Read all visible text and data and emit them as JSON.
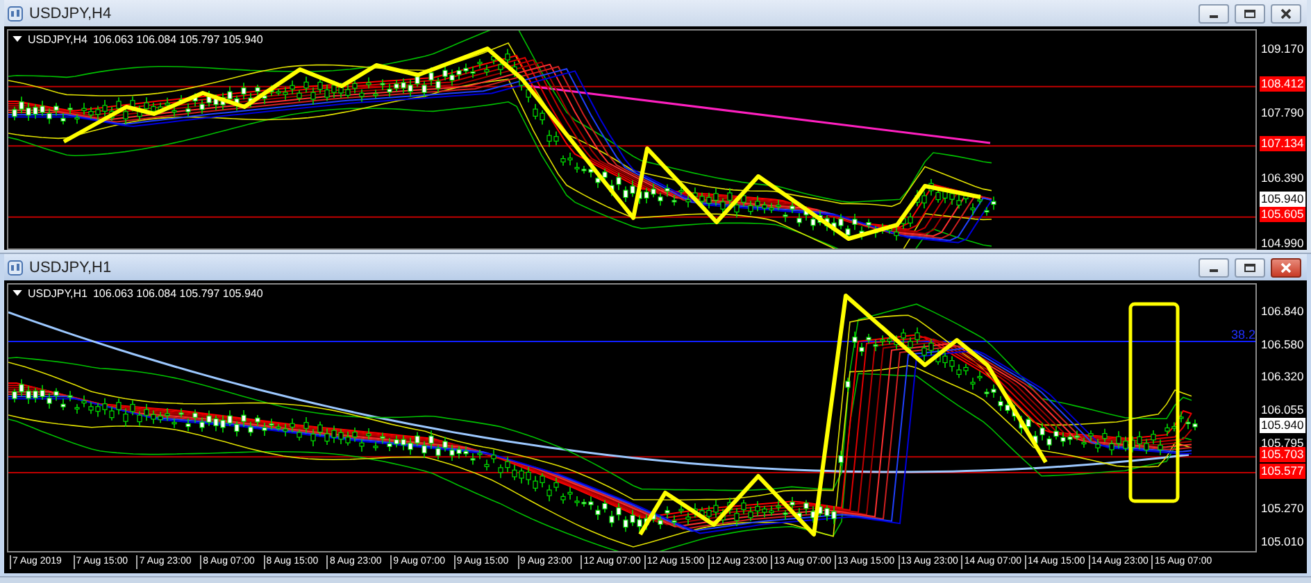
{
  "windows": [
    {
      "title": "USDJPY,H4",
      "active": false,
      "chart_header": {
        "symbol": "USDJPY,H4",
        "quote": "106.063 106.084 105.797 105.940"
      },
      "price_axis": [
        {
          "text": "109.170",
          "kind": "tick"
        },
        {
          "text": "108.412",
          "kind": "line"
        },
        {
          "text": "107.790",
          "kind": "tick"
        },
        {
          "text": "107.134",
          "kind": "line"
        },
        {
          "text": "106.390",
          "kind": "tick"
        },
        {
          "text": "105.940",
          "kind": "current"
        },
        {
          "text": "105.605",
          "kind": "line"
        },
        {
          "text": "104.990",
          "kind": "tick"
        }
      ]
    },
    {
      "title": "USDJPY,H1",
      "active": true,
      "chart_header": {
        "symbol": "USDJPY,H1",
        "quote": "106.063 106.084 105.797 105.940"
      },
      "fib_label": "38.2",
      "price_axis": [
        {
          "text": "106.840",
          "kind": "tick"
        },
        {
          "text": "106.580",
          "kind": "tick"
        },
        {
          "text": "106.320",
          "kind": "tick"
        },
        {
          "text": "106.055",
          "kind": "tick"
        },
        {
          "text": "105.940",
          "kind": "current"
        },
        {
          "text": "105.795",
          "kind": "tick"
        },
        {
          "text": "105.703",
          "kind": "line"
        },
        {
          "text": "105.577",
          "kind": "line"
        },
        {
          "text": "105.270",
          "kind": "tick"
        },
        {
          "text": "105.010",
          "kind": "tick"
        }
      ],
      "time_axis": [
        "7 Aug 2019",
        "7 Aug 15:00",
        "7 Aug 23:00",
        "8 Aug 07:00",
        "8 Aug 15:00",
        "8 Aug 23:00",
        "9 Aug 07:00",
        "9 Aug 15:00",
        "9 Aug 23:00",
        "12 Aug 07:00",
        "12 Aug 15:00",
        "12 Aug 23:00",
        "13 Aug 07:00",
        "13 Aug 15:00",
        "13 Aug 23:00",
        "14 Aug 07:00",
        "14 Aug 15:00",
        "14 Aug 23:00",
        "15 Aug 07:00"
      ]
    }
  ]
}
